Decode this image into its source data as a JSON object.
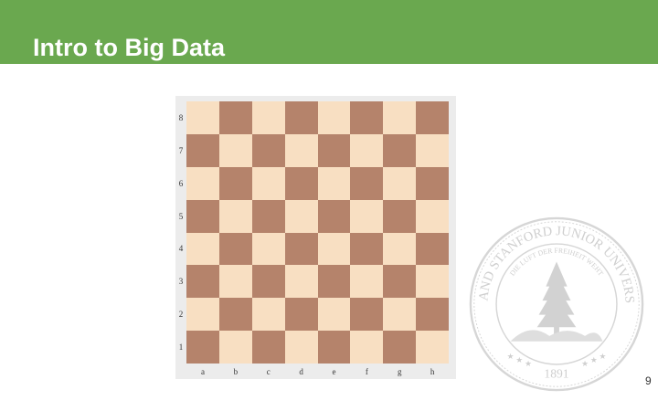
{
  "slide": {
    "title": "Intro to Big Data",
    "page_number": "9",
    "header_color": "#6aa84f"
  },
  "chessboard": {
    "files": [
      "a",
      "b",
      "c",
      "d",
      "e",
      "f",
      "g",
      "h"
    ],
    "ranks": [
      "8",
      "7",
      "6",
      "5",
      "4",
      "3",
      "2",
      "1"
    ],
    "light_color": "#f8dfc2",
    "dark_color": "#b5836b"
  },
  "seal": {
    "outer_text": "LELAND STANFORD JUNIOR UNIVERSITY",
    "motto": "DIE LUFT DER FREIHEIT WEHT",
    "year": "1891",
    "icon": "tree-icon"
  }
}
